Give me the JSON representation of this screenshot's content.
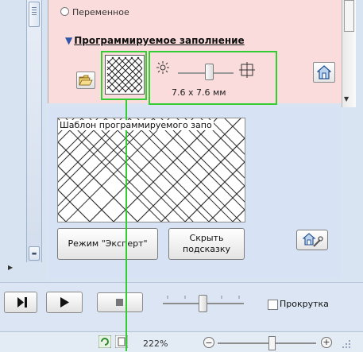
{
  "radio_option": {
    "label": "Переменное"
  },
  "programmable_fill": {
    "title": "Программируемое заполнение",
    "size_label": "7.6 x 7.6 мм"
  },
  "hint": {
    "title": "Шаблон программируемого запо"
  },
  "buttons": {
    "expert_mode": "Режим \"Эксперт\"",
    "hide_hint_line1": "Скрыть",
    "hide_hint_line2": "подсказку"
  },
  "playback": {
    "scroll_label": "Прокрутка",
    "scroll_checked": false
  },
  "status": {
    "zoom_label": "222%"
  },
  "colors": {
    "highlight": "#33cc33",
    "pink_panel": "#fbdcdc",
    "blue_panel": "#d7e3f4"
  }
}
